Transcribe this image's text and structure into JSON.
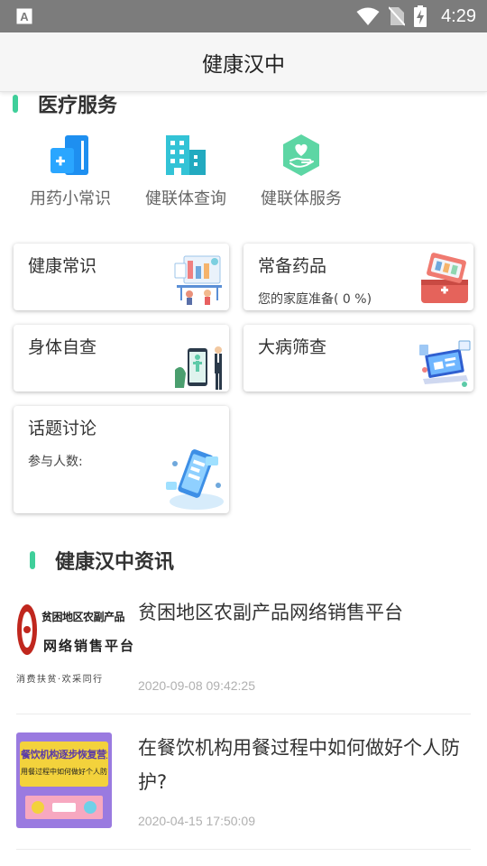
{
  "status_bar": {
    "time": "4:29"
  },
  "app_bar": {
    "title": "健康汉中"
  },
  "medical_section": {
    "title": "医疗服务"
  },
  "services": [
    {
      "label": "用药小常识",
      "icon": "medicine-guide-icon"
    },
    {
      "label": "健联体查询",
      "icon": "building-icon"
    },
    {
      "label": "健联体服务",
      "icon": "heart-hand-icon"
    }
  ],
  "cards": {
    "health_knowledge": {
      "title": "健康常识"
    },
    "common_medicine": {
      "title": "常备药品",
      "subtitle": "您的家庭准备( 0 %)",
      "percent": 0
    },
    "self_check": {
      "title": "身体自查"
    },
    "disease_screening": {
      "title": "大病筛查"
    },
    "topic_discussion": {
      "title": "话题讨论",
      "subtitle": "参与人数:"
    }
  },
  "news_section": {
    "title": "健康汉中资讯"
  },
  "news": [
    {
      "title": "贫困地区农副产品网络销售平台",
      "time": "2020-09-08 09:42:25",
      "thumb_line1": "贫困地区农副产品",
      "thumb_line2": "网络销售平台",
      "thumb_line3": "消费扶贫·欢采同行"
    },
    {
      "title": "在餐饮机构用餐过程中如何做好个人防护?",
      "time": "2020-04-15 17:50:09",
      "thumb_line1": "餐饮机构逐步恢复营业",
      "thumb_line2": "用餐过程中如何做好个人防护"
    }
  ],
  "colors": {
    "accent": "#3fcf9a",
    "status_bar": "#7c7c7c",
    "app_bar": "#f6f6f6",
    "icon_blue": "#1e8ff0",
    "icon_teal": "#33c3d6",
    "icon_green": "#5dd6a4"
  }
}
